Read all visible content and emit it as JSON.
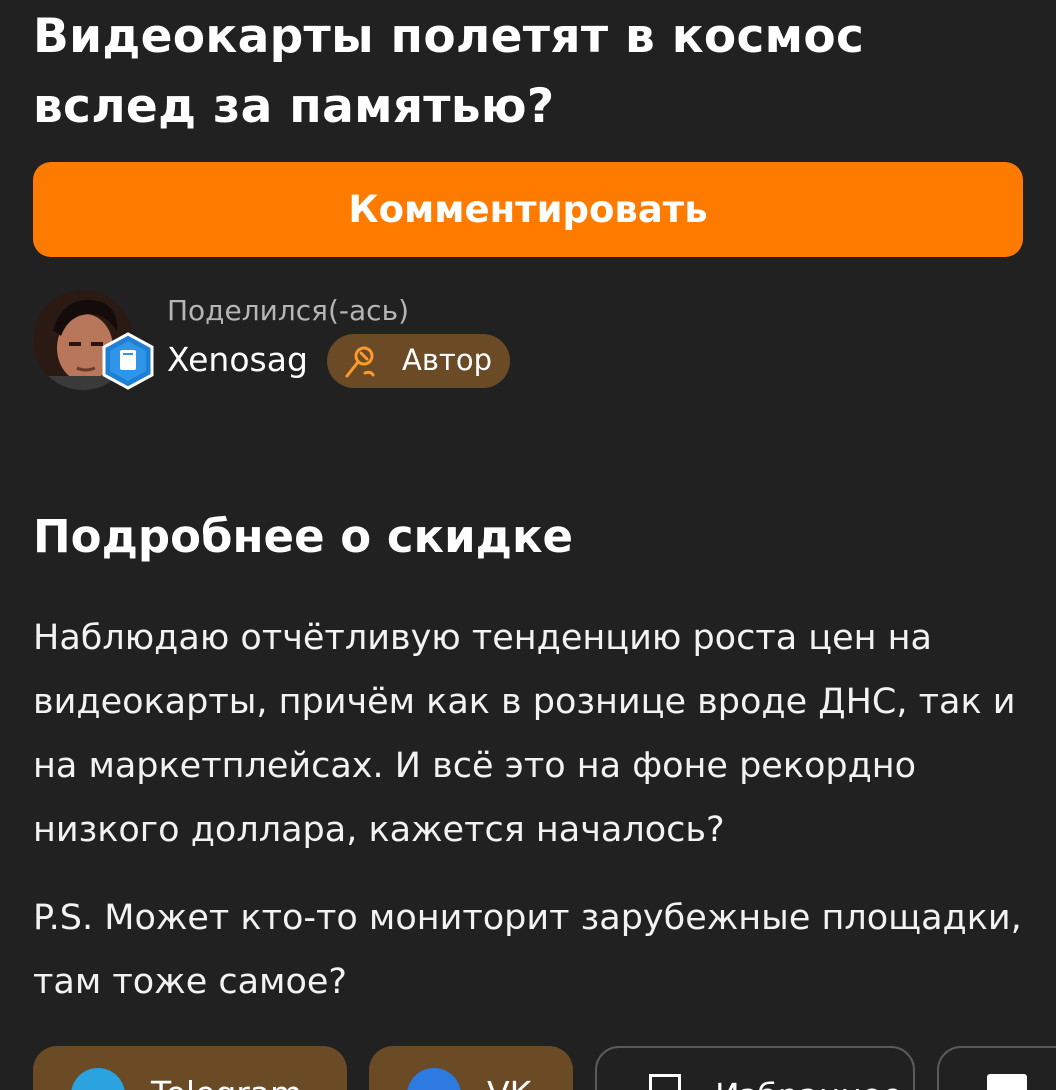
{
  "post": {
    "title": "Видеокарты полетят в космос вслед за памятью?",
    "comment_button": "Комментировать"
  },
  "author": {
    "shared_label": "Поделился(-ась)",
    "username": "Xenosag",
    "badge_label": "Автор"
  },
  "section": {
    "title": "Подробнее о скидке",
    "body": "Наблюдаю отчётливую тенденцию роста цен на видеокарты, причём как в рознице вроде ДНС, так и на маркетплейсах. И всё это на фоне рекордно низкого доллара, кажется началось?",
    "ps": "P.S. Может кто-то мониторит зарубежные площадки, там тоже самое?"
  },
  "share": {
    "buttons": [
      {
        "label": "Telegram",
        "icon": "telegram-icon"
      },
      {
        "label": "VK",
        "icon": "vk-icon"
      },
      {
        "label": "Избранное",
        "icon": "bookmark-icon"
      },
      {
        "label": "",
        "icon": "document-icon"
      }
    ]
  },
  "colors": {
    "background": "#212121",
    "accent": "#ff7b00",
    "badge_bg": "#6b4a26",
    "muted_text": "#b5b5b5"
  }
}
